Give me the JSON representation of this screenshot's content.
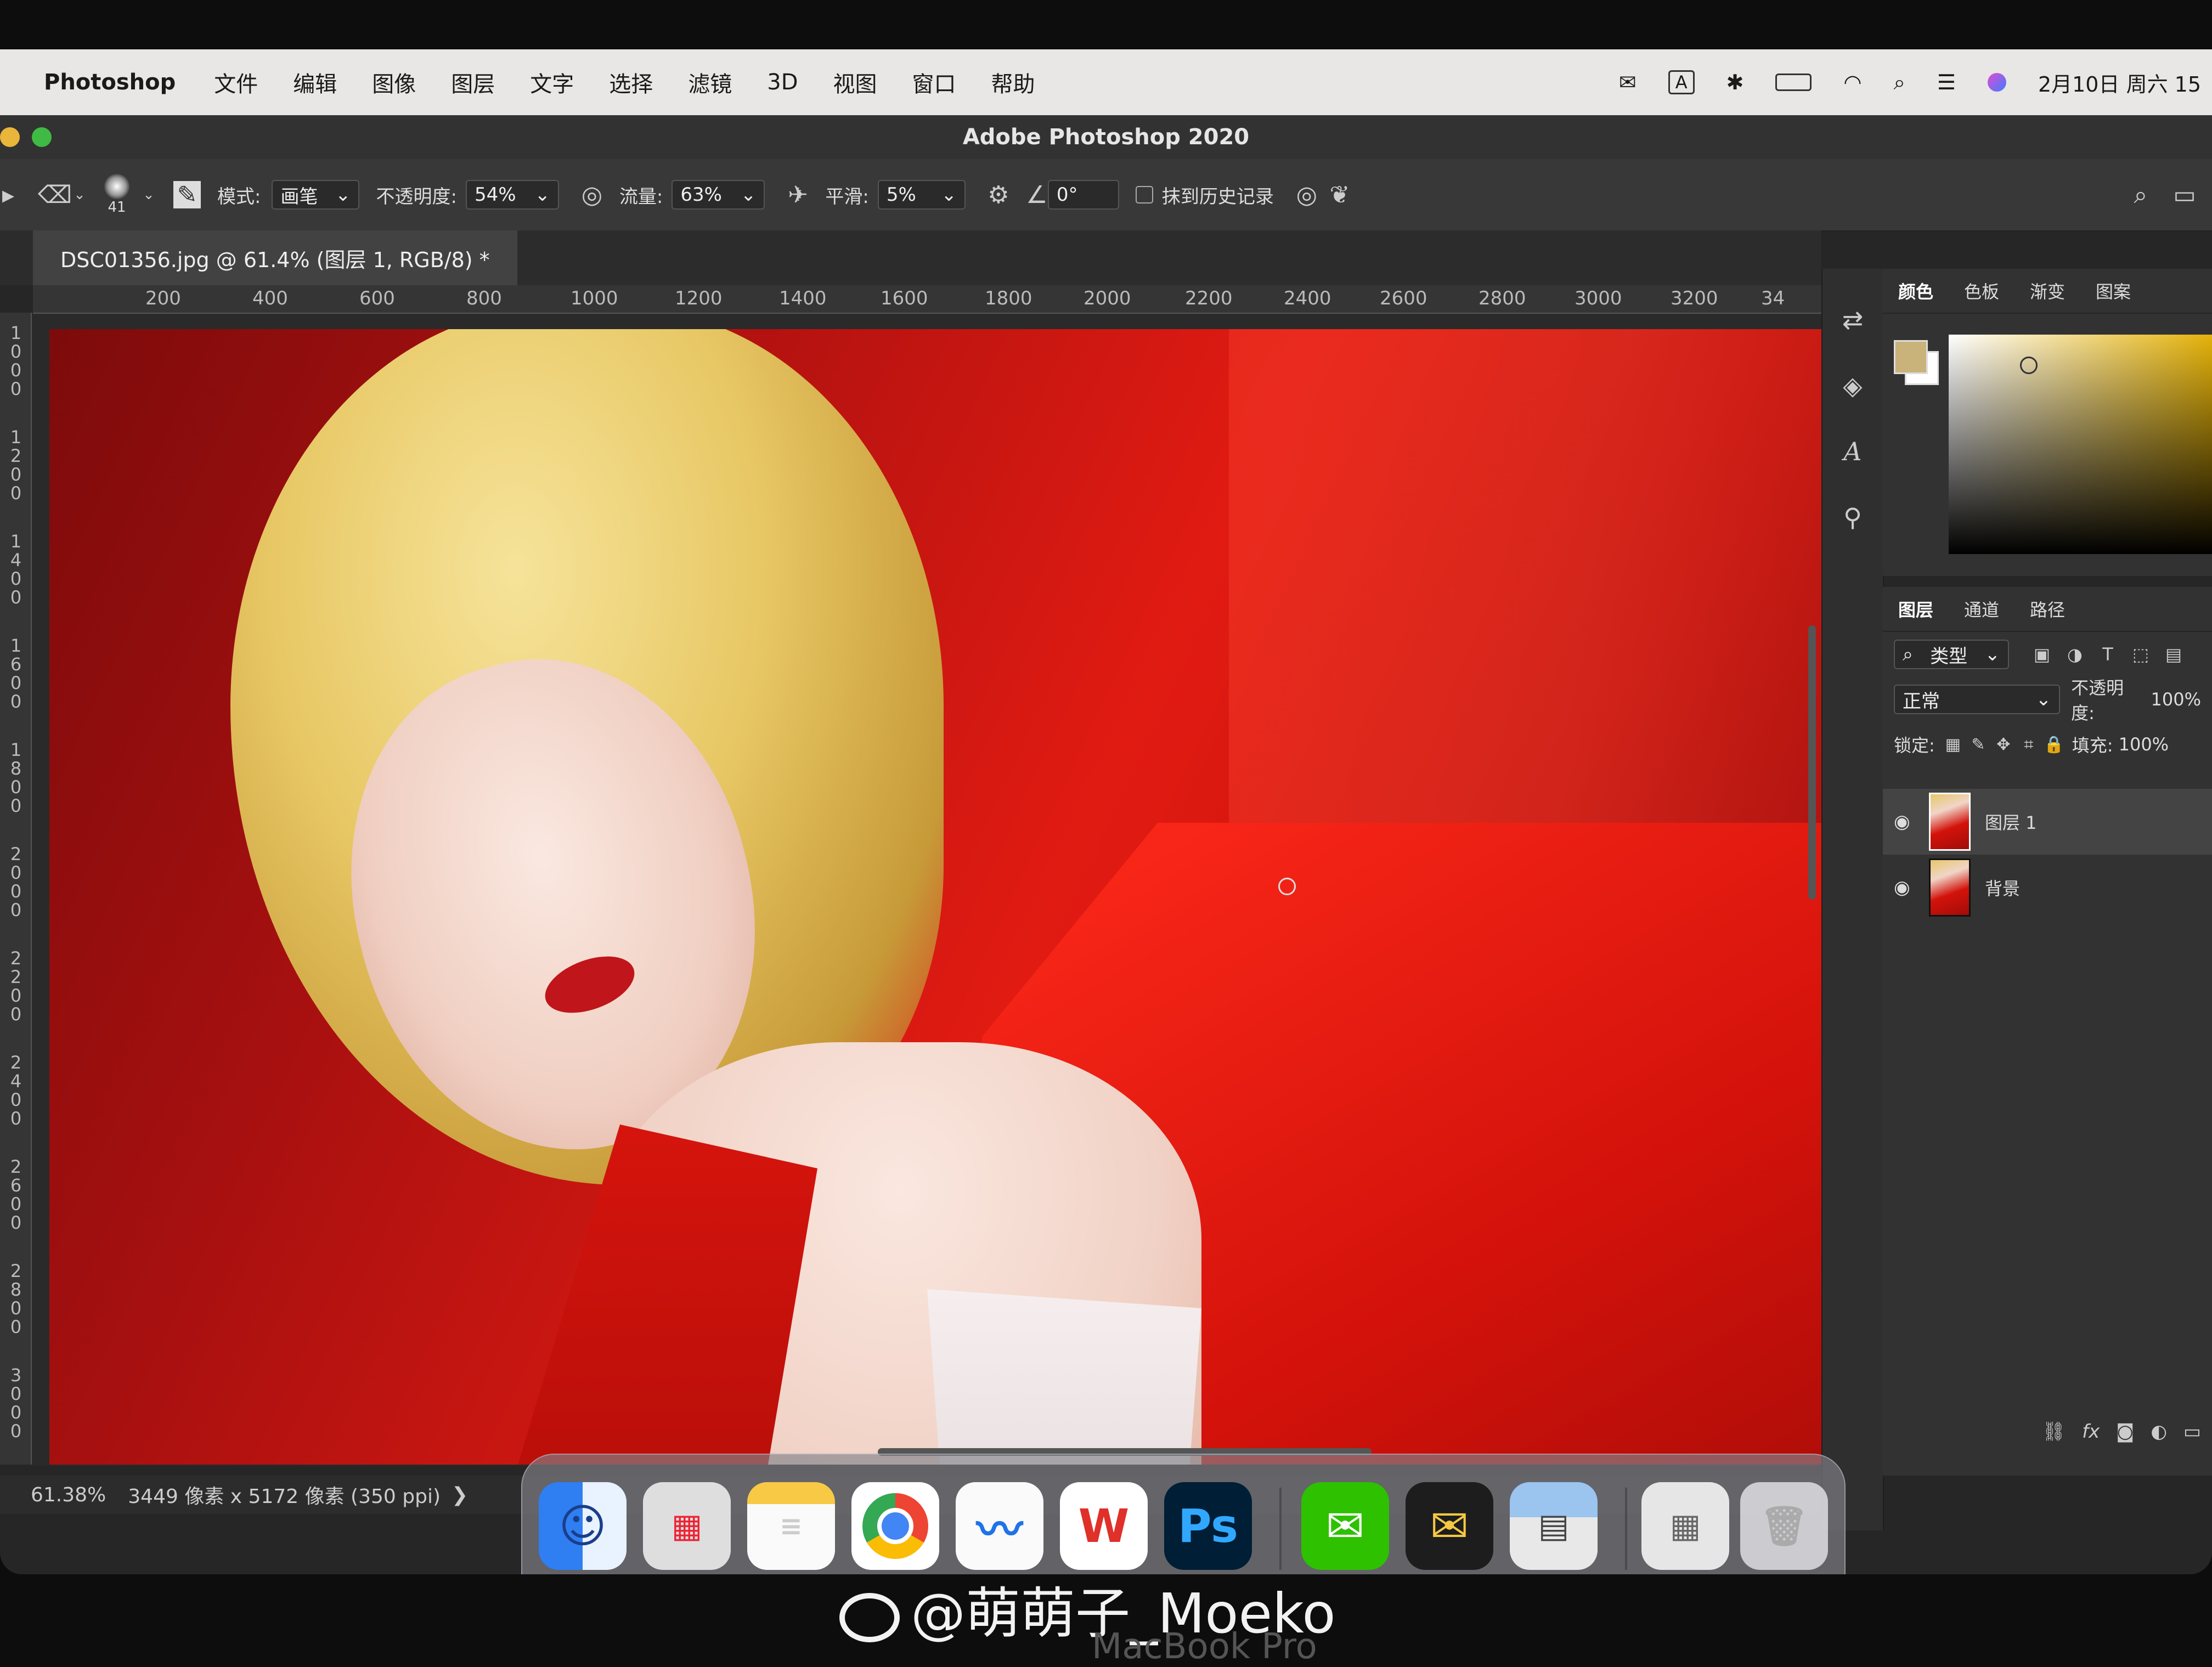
{
  "menubar": {
    "app": "Photoshop",
    "items": [
      "文件",
      "编辑",
      "图像",
      "图层",
      "文字",
      "选择",
      "滤镜",
      "3D",
      "视图",
      "窗口",
      "帮助"
    ],
    "right": {
      "input": "A",
      "datetime": "2月10日 周六 15"
    }
  },
  "window": {
    "title": "Adobe Photoshop 2020"
  },
  "options": {
    "brush_size": "41",
    "mode_label": "模式:",
    "mode_value": "画笔",
    "opacity_label": "不透明度:",
    "opacity_value": "54%",
    "flow_label": "流量:",
    "flow_value": "63%",
    "smooth_label": "平滑:",
    "smooth_value": "5%",
    "angle_value": "0°",
    "erase_history_label": "抹到历史记录"
  },
  "document": {
    "tab": "DSC01356.jpg @ 61.4% (图层 1, RGB/8) *",
    "ruler_h": [
      "200",
      "400",
      "600",
      "800",
      "1000",
      "1200",
      "1400",
      "1600",
      "1800",
      "2000",
      "2200",
      "2400",
      "2600",
      "2800",
      "3000",
      "3200",
      "34"
    ],
    "ruler_v": [
      "1000",
      "1200",
      "1400",
      "1600",
      "1800",
      "2000",
      "2200",
      "2400",
      "2600",
      "2800",
      "3000"
    ]
  },
  "status": {
    "zoom": "61.38%",
    "info": "3449 像素 x 5172 像素 (350 ppi)",
    "arrow": "❯"
  },
  "color_panel": {
    "tabs": [
      "颜色",
      "色板",
      "渐变",
      "图案"
    ],
    "fg": "#c9b37a",
    "bg": "#ffffff",
    "hue": "#e4b20a"
  },
  "layers_panel": {
    "tabs": [
      "图层",
      "通道",
      "路径"
    ],
    "filter": "类型",
    "blend_mode": "正常",
    "opacity_label": "不透明度:",
    "opacity_value": "100%",
    "lock_label": "锁定:",
    "fill_label": "填充:",
    "fill_value": "100%",
    "layers": [
      {
        "name": "图层 1",
        "selected": true
      },
      {
        "name": "背景",
        "selected": false
      }
    ],
    "fx": "fx"
  },
  "dock": {
    "ps_label": "Ps"
  },
  "watermark": "@萌萌子_Moeko",
  "bezel": "MacBook Pro"
}
